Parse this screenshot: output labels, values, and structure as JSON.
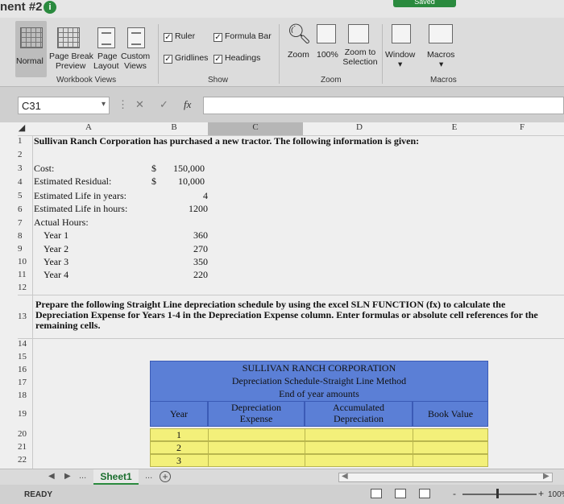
{
  "window": {
    "title": "nent #2",
    "saved_label": "Saved"
  },
  "ribbon": {
    "views": [
      {
        "label": "Normal",
        "selected": true
      },
      {
        "label": "Page Break Preview"
      },
      {
        "label": "Page Layout"
      },
      {
        "label": "Custom Views"
      }
    ],
    "views_line1": [
      "Normal",
      "Page Break",
      "Page",
      "Custom"
    ],
    "views_line2": [
      "Preview",
      "Layout",
      "Views"
    ],
    "show": {
      "ruler": "Ruler",
      "formula_bar": "Formula Bar",
      "gridlines": "Gridlines",
      "headings": "Headings"
    },
    "zoom": {
      "zoom": "Zoom",
      "zoom100": "100%",
      "zoom_to1": "Zoom to",
      "zoom_to2": "Selection"
    },
    "window_label": "Window",
    "macros_label": "Macros",
    "group_labels": {
      "workbook_views": "Workbook Views",
      "show": "Show",
      "zoom": "Zoom",
      "macros": "Macros"
    }
  },
  "formula_bar": {
    "name_box": "C31",
    "fx": "fx",
    "cancel": "✕",
    "enter": "✓",
    "formula": ""
  },
  "columns": [
    "A",
    "B",
    "C",
    "D",
    "E",
    "F"
  ],
  "rows": [
    "1",
    "2",
    "3",
    "4",
    "5",
    "6",
    "7",
    "8",
    "9",
    "10",
    "11",
    "12",
    "13",
    "14",
    "15",
    "16",
    "17",
    "18",
    "19",
    "20",
    "21",
    "22"
  ],
  "cells": {
    "a1": "Sullivan Ranch Corporation has purchased a new tractor. The following information is given:",
    "a3": "Cost:",
    "b3_cur": "$",
    "b3": "150,000",
    "a4": "Estimated Residual:",
    "b4_cur": "$",
    "b4": "10,000",
    "a5": "Estimated Life in years:",
    "b5": "4",
    "a6": "Estimated Life in hours:",
    "b6": "1200",
    "a7": "Actual Hours:",
    "a8": "Year 1",
    "b8": "360",
    "a9": "Year 2",
    "b9": "270",
    "a10": "Year 3",
    "b10": "350",
    "a11": "Year 4",
    "b11": "220",
    "a13": "Prepare the following Straight Line depreciation schedule by using the excel SLN FUNCTION (fx) to calculate the Depreciation Expense for Years 1-4 in the Depreciation Expense column. Enter formulas or absolute cell references for the remaining cells."
  },
  "schedule": {
    "title1": "SULLIVAN RANCH CORPORATION",
    "title2": "Depreciation Schedule-Straight Line Method",
    "title3": "End of year amounts",
    "col_year": "Year",
    "col_dep1": "Depreciation",
    "col_dep2": "Expense",
    "col_acc1": "Accumulated",
    "col_acc2": "Depreciation",
    "col_book": "Book Value",
    "years": [
      "1",
      "2",
      "3"
    ]
  },
  "tabs": {
    "sheet1": "Sheet1",
    "add": "+",
    "ellipsis": "..."
  },
  "status": {
    "ready": "READY",
    "zoom": "100%"
  },
  "colors": {
    "header_blue": "#5b7fd6",
    "input_yellow": "#f3f07a",
    "saved_green": "#2a8a3e"
  }
}
